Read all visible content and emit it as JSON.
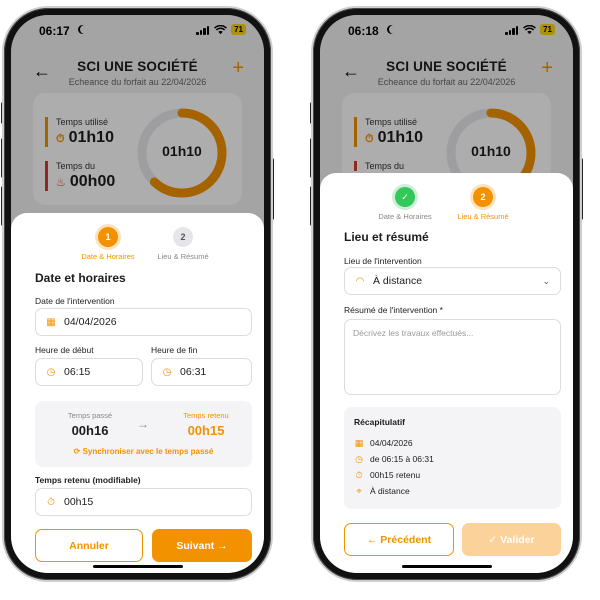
{
  "colors": {
    "accent": "#f39200",
    "accent_light": "#fbd29a",
    "danger": "#d83a2e",
    "success": "#34c759"
  },
  "left": {
    "status": {
      "time": "06:17",
      "battery": "71"
    },
    "header": {
      "title": "SCI UNE SOCIÉTÉ",
      "subtitle": "Echeance du forfait au 22/04/2026"
    },
    "card": {
      "used_label": "Temps utilisé",
      "used_value": "01h10",
      "due_label": "Temps du",
      "due_value": "00h00",
      "ring_value": "01h10",
      "ring_progress": 0.62
    },
    "steps": [
      {
        "num": "1",
        "label": "Date & Horaires",
        "state": "active"
      },
      {
        "num": "2",
        "label": "Lieu & Résumé",
        "state": "idle"
      }
    ],
    "section_title": "Date et horaires",
    "date_label": "Date de l'intervention",
    "date_value": "04/04/2026",
    "start_label": "Heure de début",
    "start_value": "06:15",
    "end_label": "Heure de fin",
    "end_value": "06:31",
    "sync": {
      "passed_label": "Temps passé",
      "passed_value": "00h16",
      "kept_label": "Temps retenu",
      "kept_value": "00h15",
      "link": "Synchroniser avec le temps passé"
    },
    "kept_label": "Temps retenu (modifiable)",
    "kept_value": "00h15",
    "cancel": "Annuler",
    "next": "Suivant →"
  },
  "right": {
    "status": {
      "time": "06:18",
      "battery": "71"
    },
    "header": {
      "title": "SCI UNE SOCIÉTÉ",
      "subtitle": "Echeance du forfait au 22/04/2026"
    },
    "card": {
      "used_label": "Temps utilisé",
      "used_value": "01h10",
      "due_label": "Temps du",
      "ring_value": "01h10",
      "ring_progress": 0.62
    },
    "steps": [
      {
        "num": "✓",
        "label": "Date & Horaires",
        "state": "done"
      },
      {
        "num": "2",
        "label": "Lieu & Résumé",
        "state": "active"
      }
    ],
    "section_title": "Lieu et résumé",
    "place_label": "Lieu de l'intervention",
    "place_value": "À distance",
    "summary_label": "Résumé de l'intervention *",
    "summary_placeholder": "Décrivez les travaux effectués...",
    "recap": {
      "title": "Récapitulatif",
      "date": "04/04/2026",
      "range": "de 06:15 à 06:31",
      "kept": "00h15 retenu",
      "place": "À distance"
    },
    "prev": "← Précédent",
    "validate": "✓ Valider"
  }
}
